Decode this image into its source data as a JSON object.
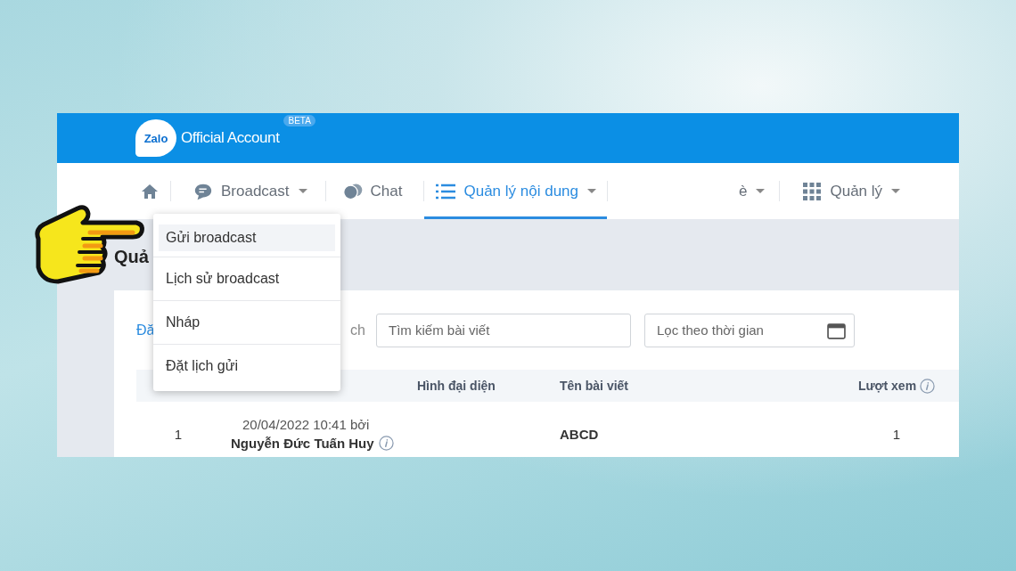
{
  "header": {
    "logo_text": "Zalo",
    "title": "Official Account",
    "badge": "BETA"
  },
  "nav": [
    {
      "kind": "home",
      "dropdown": false,
      "selected": false
    },
    {
      "kind": "broadcast",
      "label": "Broadcast",
      "dropdown": true,
      "selected": false
    },
    {
      "kind": "chat",
      "label": "Chat",
      "dropdown": false,
      "selected": false
    },
    {
      "kind": "content",
      "label": "Quản lý nội dung",
      "dropdown": true,
      "selected": true
    },
    {
      "kind": "partial",
      "label": "è",
      "dropdown": true,
      "selected": false
    },
    {
      "kind": "manage",
      "label": "Quản lý",
      "dropdown": true,
      "selected": false
    }
  ],
  "page_title": "Quả",
  "dropdown_menu": [
    {
      "label": "Gửi broadcast",
      "selected": true
    },
    {
      "label": "Lịch sử broadcast",
      "selected": false
    },
    {
      "label": "Nháp",
      "selected": false
    },
    {
      "label": "Đặt lịch gửi",
      "selected": false
    }
  ],
  "filters": {
    "tab_partial": "Đă",
    "label_partial": "ch",
    "search": {
      "placeholder": "Tìm kiếm bài viết"
    },
    "date": {
      "placeholder": "Lọc theo thời gian"
    }
  },
  "table": {
    "columns": [
      "Hình đại diện",
      "Tên bài viết",
      "Lượt xem"
    ],
    "rows": [
      {
        "index": "1",
        "date": "20/04/2022 10:41 bởi",
        "author": "Nguyễn Đức Tuấn Huy",
        "title": "ABCD",
        "views": "1"
      }
    ]
  }
}
